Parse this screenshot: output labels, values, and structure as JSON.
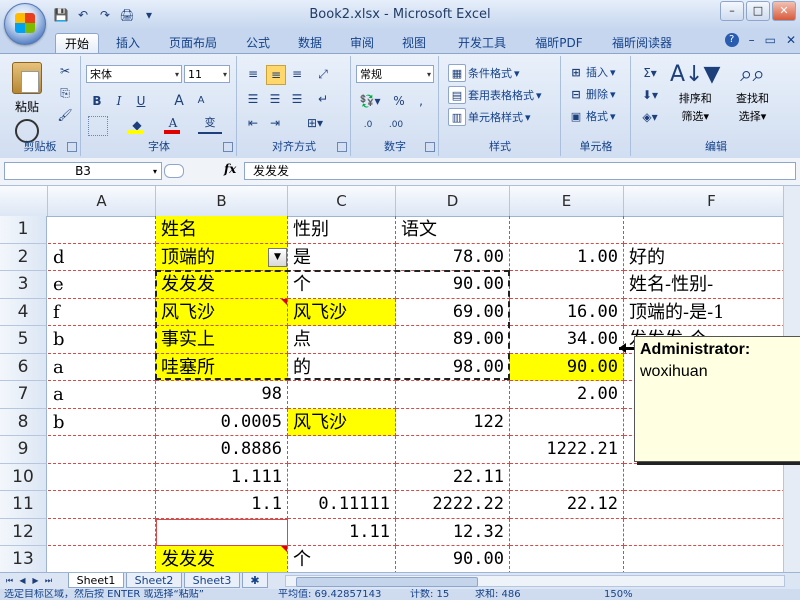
{
  "window": {
    "title": "Book2.xlsx - Microsoft Excel",
    "controls": [
      "–",
      "□",
      "✕"
    ]
  },
  "qat": {
    "save": "💾",
    "undo": "↶",
    "redo": "↷",
    "print_preview": "🖨"
  },
  "ribbon_tabs": [
    "开始",
    "插入",
    "页面布局",
    "公式",
    "数据",
    "审阅",
    "视图",
    "开发工具",
    "福昕PDF",
    "福昕阅读器"
  ],
  "ribbon_right": {
    "help": "?",
    "min": "–",
    "restore": "▭",
    "close": "✕"
  },
  "clipboard": {
    "paste_label": "粘贴",
    "group_label": "剪贴板"
  },
  "font": {
    "name": "宋体",
    "size": "11",
    "group_label": "字体",
    "bold": "B",
    "italic": "I",
    "underline": "U",
    "grow": "A",
    "shrink": "A",
    "phonetic": "变"
  },
  "alignment": {
    "group_label": "对齐方式"
  },
  "number": {
    "format": "常规",
    "group_label": "数字",
    "percent": "%",
    "comma": ",",
    "inc": ".0→.00",
    "dec": ".00→.0"
  },
  "styles": {
    "conditional": "条件格式",
    "table": "套用表格格式",
    "cell": "单元格样式",
    "group_label": "样式"
  },
  "cells": {
    "insert": "插入",
    "delete": "删除",
    "format": "格式",
    "group_label": "单元格"
  },
  "editing": {
    "sigma": "Σ",
    "sort_filter": "排序和",
    "sort_filter2": "筛选",
    "find_select": "查找和",
    "find_select2": "选择",
    "group_label": "编辑"
  },
  "formula_bar": {
    "name_box": "B3",
    "fx": "fx",
    "content": "发发发"
  },
  "columns": [
    "A",
    "B",
    "C",
    "D",
    "E",
    "F"
  ],
  "rows": [
    "1",
    "2",
    "3",
    "4",
    "5",
    "6",
    "7",
    "8",
    "9",
    "10",
    "11",
    "12",
    "13"
  ],
  "cells_data": {
    "B1": "姓名",
    "C1": "性别",
    "D1": "语文",
    "A2": "d",
    "B2": "顶端的",
    "C2": "是",
    "D2": "78.00",
    "E2": "1.00",
    "F2": "好的",
    "A3": "e",
    "B3": "发发发",
    "C3": "个",
    "D3": "90.00",
    "F3": "姓名-性别-",
    "A4": "f",
    "B4": "风飞沙",
    "C4": "风飞沙",
    "D4": "69.00",
    "E4": "16.00",
    "F4": "顶端的-是-1",
    "A5": "b",
    "B5": "事实上",
    "C5": "点",
    "D5": "89.00",
    "E5": "34.00",
    "F5": "发发发-个-",
    "A6": "a",
    "B6": "哇塞所",
    "C6": "的",
    "D6": "98.00",
    "E6": "90.00",
    "A7": "a",
    "B7": "98",
    "E7": "2.00",
    "A8": "b",
    "B8": "0.0005",
    "C8": "风飞沙",
    "D8": "122",
    "B9": "0.8886",
    "E9": "1222.21",
    "B10": "1.111",
    "D10": "22.11",
    "B11": "1.1",
    "C11": "0.11111",
    "D11": "2222.22",
    "E11": "22.12",
    "C12": "1.11",
    "D12": "12.32",
    "B13": "发发发",
    "C13": "个",
    "D13": "90.00"
  },
  "comment": {
    "author": "Administrator:",
    "text": "woxihuan"
  },
  "sheets": [
    "Sheet1",
    "Sheet2",
    "Sheet3"
  ],
  "status": {
    "message": "选定目标区域，然后按 ENTER 或选择“粘贴”",
    "average": "平均值: 69.42857143",
    "count": "计数: 15",
    "sum": "求和: 486",
    "zoom": "150%"
  },
  "colors": {
    "highlight": "#ffff00",
    "comment_bg": "#ffffe1",
    "gridline": "#d34b4b"
  }
}
